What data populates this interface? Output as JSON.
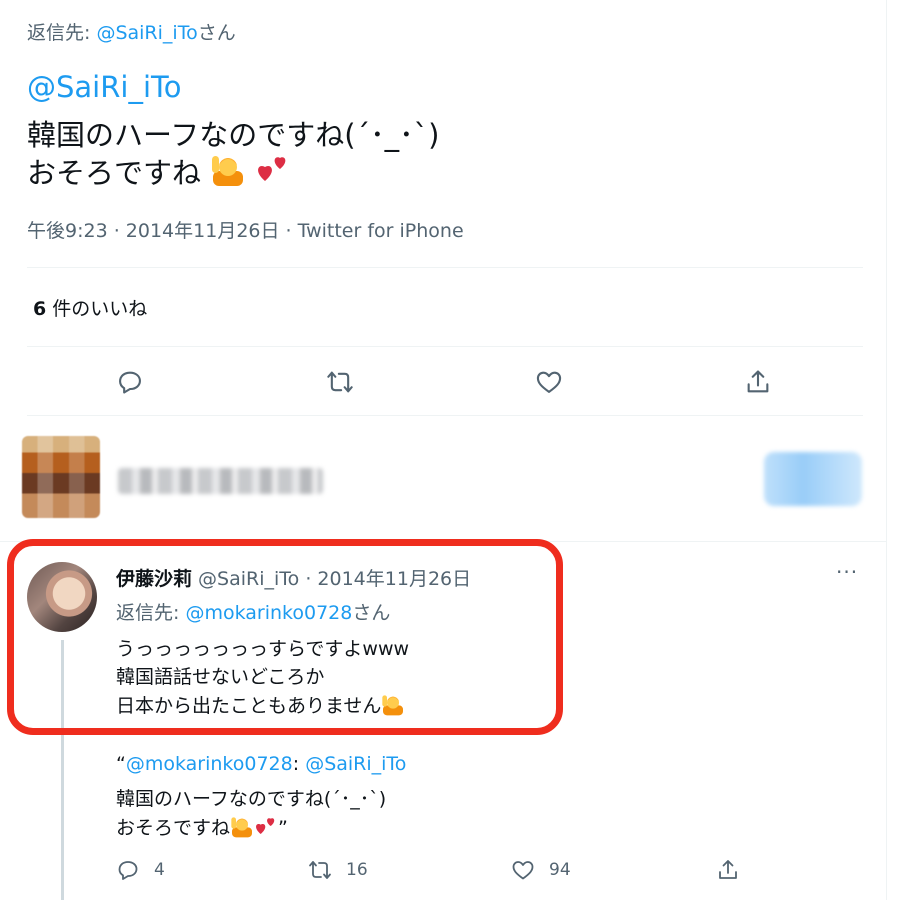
{
  "main_tweet": {
    "reply_prefix": "返信先: ",
    "reply_handle": "@SaiRi_iTo",
    "reply_suffix": "さん",
    "mention": "@SaiRi_iTo",
    "line1": "韓国のハーフなのですね(´･_･`)",
    "line2": "おそろですね",
    "timestamp": "午後9:23 · 2014年11月26日 · Twitter for iPhone",
    "likes_count": "6",
    "likes_label": "件のいいね"
  },
  "reply_tweet": {
    "display_name": "伊藤沙莉",
    "handle_date": " @SaiRi_iTo · 2014年11月26日",
    "more": "···",
    "reply_prefix": "返信先: ",
    "reply_handle": "@mokarinko0728",
    "reply_suffix": "さん",
    "line1": "うっっっっっっっすらですよwww",
    "line2": "韓国語話せないどころか",
    "line3": "日本から出たこともありません",
    "quote_open": "“",
    "quote_mention1": "@mokarinko0728",
    "quote_colon": ": ",
    "quote_mention2": "@SaiRi_iTo",
    "quote_line2": "韓国のハーフなのですね(´･_･`)",
    "quote_line3": "おそろですね",
    "quote_close": "”",
    "stats": {
      "replies": "4",
      "retweets": "16",
      "likes": "94"
    }
  },
  "icons": [
    "reply-icon",
    "retweet-icon",
    "like-icon",
    "share-icon",
    "raising-hand-emoji",
    "two-hearts-emoji"
  ],
  "colors": {
    "link": "#1d9bf0",
    "secondary": "#536471",
    "highlight": "#ef2d1e"
  }
}
